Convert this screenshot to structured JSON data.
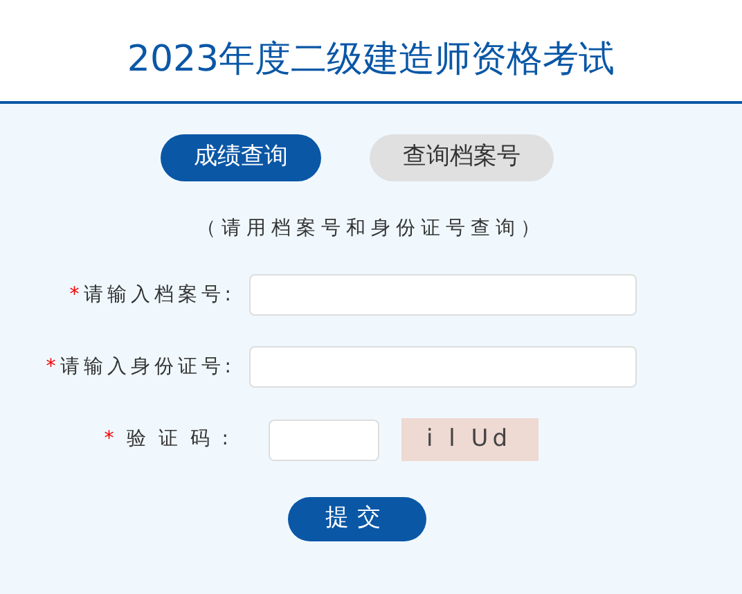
{
  "title": "2023年度二级建造师资格考试",
  "tabs": [
    {
      "label": "成绩查询",
      "selected": true
    },
    {
      "label": "查询档案号",
      "selected": false
    }
  ],
  "hint": "（请用档案号和身份证号查询）",
  "fields": [
    {
      "kind": "text",
      "required_mark": "*",
      "label": "请输入档案号:"
    },
    {
      "kind": "text",
      "required_mark": "*",
      "label": "请输入身份证号:"
    },
    {
      "kind": "captcha",
      "required_mark": "*",
      "label": "验证码:",
      "captcha_text": "i l Ud"
    }
  ],
  "submit": "提交"
}
